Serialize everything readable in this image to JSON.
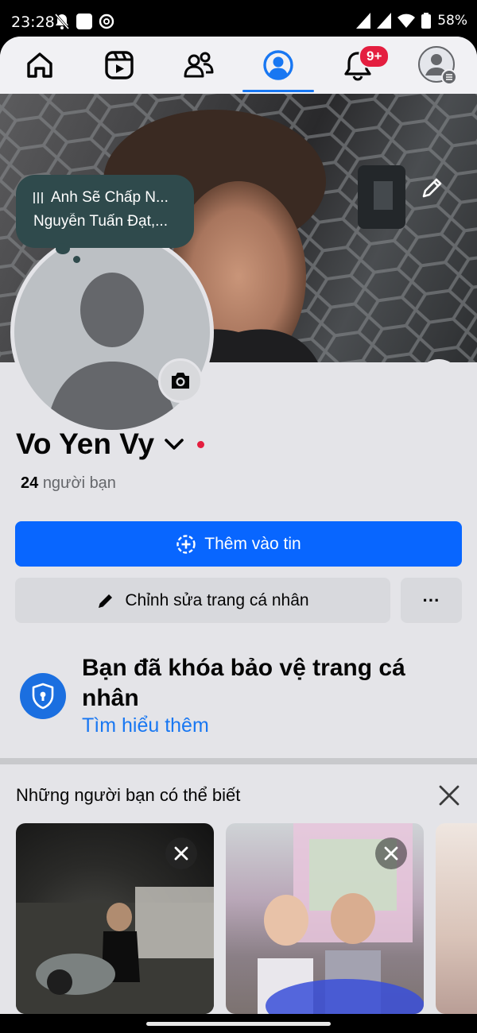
{
  "status_bar": {
    "time": "23:28",
    "battery": "58%",
    "left_icons": [
      "mute-bell-icon",
      "app-square-icon",
      "threads-icon"
    ],
    "right_icons": [
      "signal-icon",
      "signal-icon",
      "wifi-icon",
      "battery-icon"
    ]
  },
  "nav": {
    "items": [
      "home-icon",
      "video-icon",
      "friends-icon",
      "profile-icon",
      "notifications-icon",
      "menu-avatar-icon"
    ],
    "active": "profile-icon",
    "notification_badge": "9+"
  },
  "music_note": {
    "song": "Anh Sẽ Chấp N...",
    "artist": "Nguyễn Tuấn Đạt,..."
  },
  "profile": {
    "name": "Vo Yen Vy",
    "friend_count": "24",
    "friend_label": "người bạn"
  },
  "actions": {
    "add_story": "Thêm vào tin",
    "edit_profile": "Chỉnh sửa trang cá nhân",
    "more": "···"
  },
  "lock_notice": {
    "title": "Bạn đã khóa bảo vệ trang cá nhân",
    "link": "Tìm hiểu thêm"
  },
  "pymk": {
    "title": "Những người bạn có thể biết"
  },
  "colors": {
    "brand_blue": "#0866ff",
    "badge_red": "#e41e3f",
    "bubble": "#2f4a4c"
  }
}
